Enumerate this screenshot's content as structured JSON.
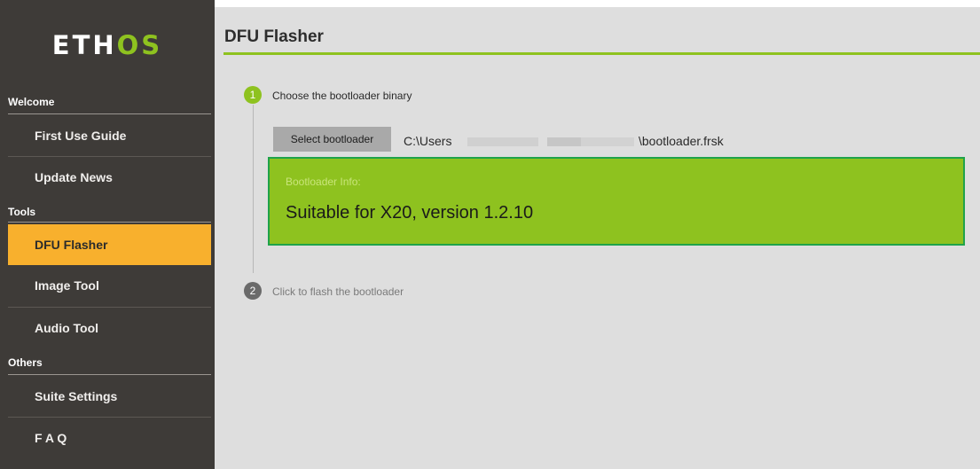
{
  "app": {
    "logo_prefix": "ETH",
    "logo_accent": "OS"
  },
  "sidebar": {
    "sections": [
      {
        "label": "Welcome"
      },
      {
        "label": "Tools"
      },
      {
        "label": "Others"
      }
    ],
    "items": [
      {
        "label": "First Use Guide"
      },
      {
        "label": "Update News"
      },
      {
        "label": "DFU Flasher"
      },
      {
        "label": "Image Tool"
      },
      {
        "label": "Audio Tool"
      },
      {
        "label": "Suite Settings"
      },
      {
        "label": "F A Q"
      }
    ],
    "active_item": "DFU Flasher"
  },
  "main": {
    "title": "DFU Flasher",
    "steps": [
      {
        "number": "1",
        "label": "Choose the bootloader binary"
      },
      {
        "number": "2",
        "label": "Click to flash the bootloader"
      }
    ],
    "select_button_label": "Select bootloader",
    "path_prefix": "C:\\Users",
    "path_suffix": "\\bootloader.frsk",
    "info": {
      "label": "Bootloader Info:",
      "value": "Suitable for X20, version 1.2.10"
    }
  },
  "colors": {
    "sidebar_bg": "#3e3b38",
    "active_item": "#f8b02d",
    "accent_green": "#8ec21f",
    "info_border": "#1fa34a",
    "main_bg": "#dedede"
  }
}
